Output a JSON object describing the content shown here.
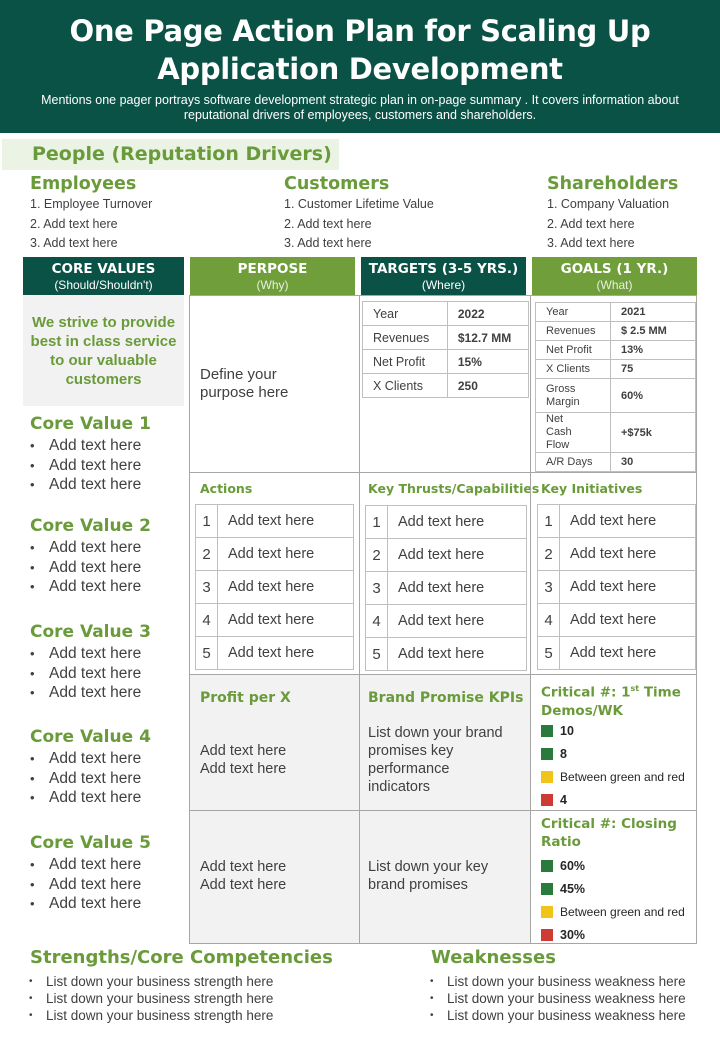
{
  "header": {
    "title_line1": "One Page Action Plan for Scaling Up",
    "title_line2": "Application Development",
    "subtitle": "Mentions one pager portrays software development  strategic plan in on-page summary . It covers information about reputational drivers of employees, customers and shareholders."
  },
  "people": {
    "title": "People (Reputation Drivers)",
    "groups": [
      {
        "title": "Employees",
        "items": [
          "1. Employee Turnover",
          "2. Add text here",
          "3. Add text here"
        ]
      },
      {
        "title": "Customers",
        "items": [
          "1. Customer Lifetime Value",
          "2. Add text here",
          "3. Add text here"
        ]
      },
      {
        "title": "Shareholders",
        "items": [
          "1. Company Valuation",
          "2. Add text here",
          "3. Add text here"
        ]
      }
    ]
  },
  "columns": [
    {
      "title": "CORE VALUES",
      "subtitle": "(Should/Shouldn't)"
    },
    {
      "title": "PERPOSE",
      "subtitle": "(Why)"
    },
    {
      "title": "TARGETS (3-5 YRS.)",
      "subtitle": "(Where)"
    },
    {
      "title": "GOALS (1 YR.)",
      "subtitle": "(What)"
    }
  ],
  "core_values": {
    "mission": "We strive to provide best in class service to our valuable customers",
    "values": [
      {
        "title": "Core Value 1",
        "items": [
          "Add text here",
          "Add text here",
          "Add text here"
        ]
      },
      {
        "title": "Core Value 2",
        "items": [
          "Add text here",
          "Add text here",
          "Add text here"
        ]
      },
      {
        "title": "Core Value 3",
        "items": [
          "Add text here",
          "Add text here",
          "Add text here"
        ]
      },
      {
        "title": "Core Value 4",
        "items": [
          "Add text here",
          "Add text here",
          "Add text here"
        ]
      },
      {
        "title": "Core Value 5",
        "items": [
          "Add text here",
          "Add text here",
          "Add text here"
        ]
      }
    ]
  },
  "purpose": {
    "text": "Define your purpose here"
  },
  "targets": {
    "rows": [
      {
        "label": "Year",
        "value": "2022"
      },
      {
        "label": "Revenues",
        "value": "$12.7 MM"
      },
      {
        "label": "Net Profit",
        "value": "15%"
      },
      {
        "label": "X Clients",
        "value": "250"
      }
    ]
  },
  "goals": {
    "rows": [
      {
        "label": "Year",
        "value": "2021"
      },
      {
        "label": "Revenues",
        "value": "$ 2.5 MM"
      },
      {
        "label": "Net Profit",
        "value": "13%"
      },
      {
        "label": "X Clients",
        "value": "75"
      },
      {
        "label": "Gross Margin",
        "value": "60%"
      },
      {
        "label": "Net Cash Flow",
        "value": "+$75k"
      },
      {
        "label": "A/R Days",
        "value": "30"
      }
    ]
  },
  "actions": {
    "title": "Actions",
    "items": [
      "Add text here",
      "Add text here",
      "Add text here",
      "Add text here",
      "Add text here"
    ]
  },
  "thrusts": {
    "title": "Key Thrusts/Capabilities",
    "items": [
      "Add text here",
      "Add text here",
      "Add text here",
      "Add text here",
      "Add text here"
    ]
  },
  "initiatives": {
    "title": "Key Initiatives",
    "items": [
      "Add text here",
      "Add text here",
      "Add text here",
      "Add text here",
      "Add text here"
    ]
  },
  "profit": {
    "title": "Profit per X",
    "text1": "Add text here\nAdd text here",
    "text2": "Add text here\nAdd text here"
  },
  "brand": {
    "title": "Brand Promise KPIs",
    "text1": "List down your brand promises key performance indicators",
    "text2": "List down your key brand promises"
  },
  "critical1": {
    "title_pre": "Critical #: 1",
    "title_sup": "st",
    "title_post": " Time Demos/WK",
    "rows": [
      {
        "label": "10",
        "color": "#2a7a3b",
        "bold": true
      },
      {
        "label": "8",
        "color": "#2a7a3b",
        "bold": true
      },
      {
        "label": "Between green  and red",
        "color": "#f0c419",
        "bold": false
      },
      {
        "label": "4",
        "color": "#d03a35",
        "bold": true
      }
    ]
  },
  "critical2": {
    "title": "Critical #: Closing Ratio",
    "rows": [
      {
        "label": "60%",
        "color": "#2a7a3b",
        "bold": true
      },
      {
        "label": "45%",
        "color": "#2a7a3b",
        "bold": true
      },
      {
        "label": "Between green  and red",
        "color": "#f0c419",
        "bold": false
      },
      {
        "label": "30%",
        "color": "#d03a35",
        "bold": true
      }
    ]
  },
  "strengths": {
    "title": "Strengths/Core  Competencies",
    "items": [
      "List down your business strength here",
      "List down your business strength here",
      "List down your business strength here"
    ]
  },
  "weaknesses": {
    "title": "Weaknesses",
    "items": [
      "List down your business weakness here",
      "List down your business weakness here",
      "List down your business weakness here"
    ]
  }
}
